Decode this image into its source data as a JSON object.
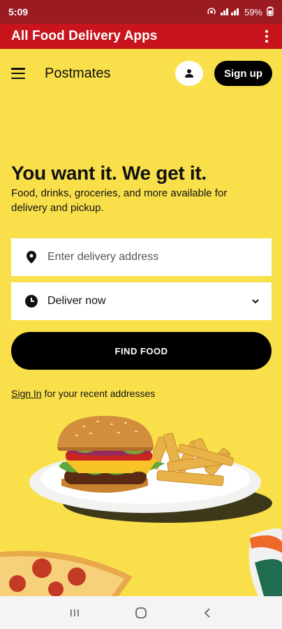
{
  "status_bar": {
    "time": "5:09",
    "indicators": "VoLTE VoLTE",
    "battery": "59%"
  },
  "app_bar": {
    "title": "All Food Delivery Apps",
    "menu_icon": "more-vert-icon"
  },
  "header": {
    "brand": "Postmates",
    "signup_label": "Sign up"
  },
  "hero": {
    "headline": "You want it. We get it.",
    "subtext": "Food, drinks, groceries, and more available for delivery and pickup."
  },
  "search": {
    "address_placeholder": "Enter delivery address",
    "deliver_label": "Deliver now",
    "find_label": "FIND FOOD"
  },
  "signin": {
    "link": "Sign In",
    "rest": " for your recent addresses"
  },
  "colors": {
    "background": "#f9e04b",
    "app_bar": "#c8141d",
    "status_bar": "#9b1b22",
    "button": "#000000"
  }
}
